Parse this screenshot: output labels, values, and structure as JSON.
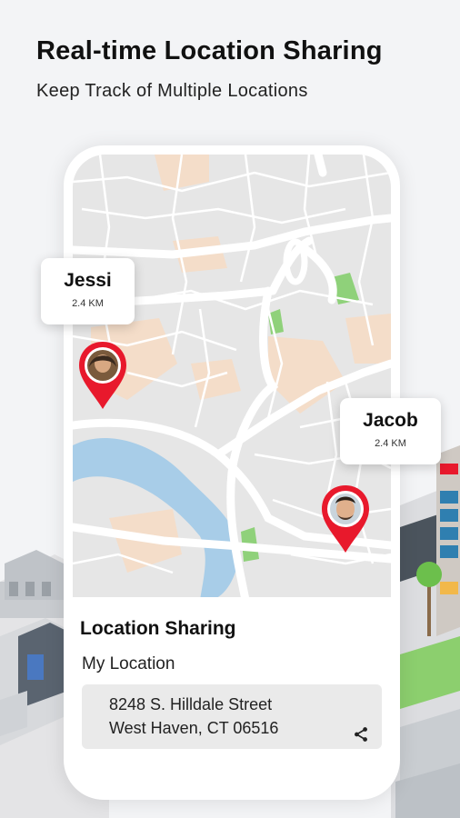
{
  "headline": "Real-time Location Sharing",
  "subline": "Keep Track of Multiple Locations",
  "markers": [
    {
      "name": "Jessi",
      "distance": "2.4 KM"
    },
    {
      "name": "Jacob",
      "distance": "2.4 KM"
    }
  ],
  "card": {
    "title": "Location Sharing",
    "subtitle": "My Location",
    "address_line1": "8248 S. Hilldale Street",
    "address_line2": "West Haven, CT 06516"
  },
  "colors": {
    "accent": "#e8192c",
    "map_background": "#e6e6e6",
    "road": "#ffffff",
    "water": "#a8cde8",
    "park": "#8fd17a",
    "residential": "#f4ddc9"
  },
  "icons": {
    "share": "share-icon",
    "pin": "map-pin-icon"
  }
}
